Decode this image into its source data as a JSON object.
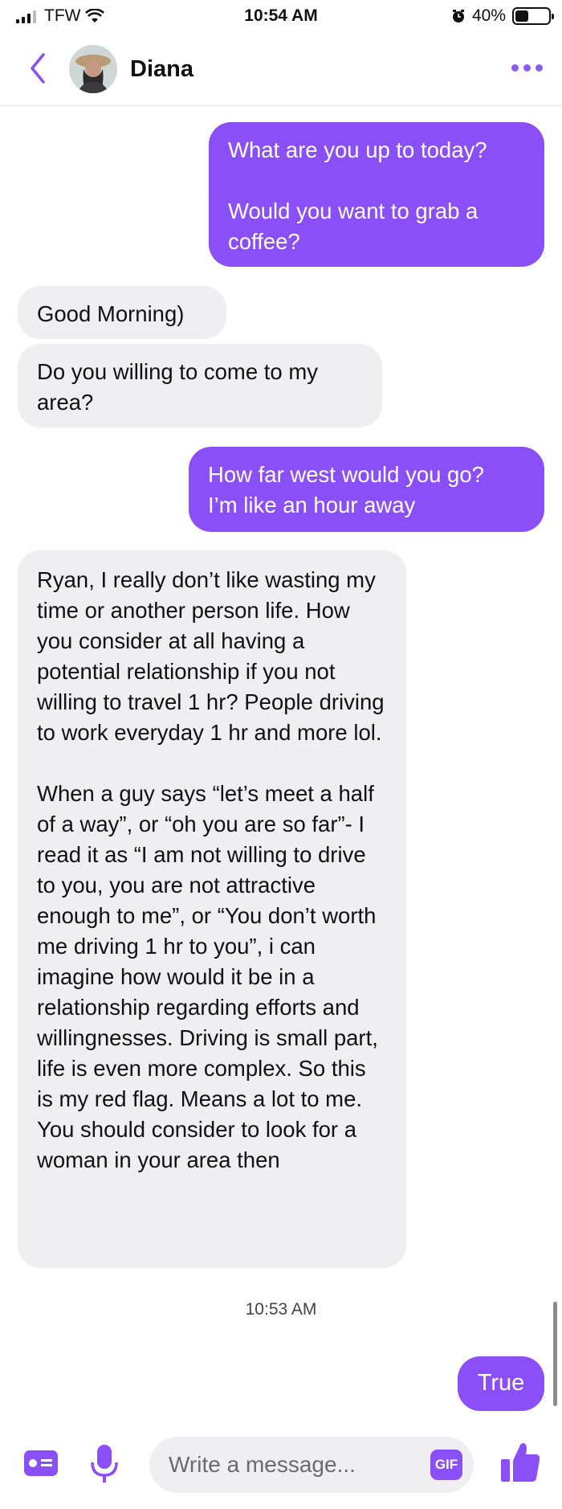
{
  "status_bar": {
    "carrier": "TFW",
    "time": "10:54 AM",
    "battery_percent": "40%",
    "battery_level": 0.4,
    "icons": [
      "signal-icon",
      "wifi-icon",
      "alarm-icon",
      "battery-icon"
    ]
  },
  "header": {
    "contact_name": "Diana",
    "icons": [
      "back-chevron-icon",
      "avatar",
      "more-dots-icon"
    ]
  },
  "messages": [
    {
      "from": "me",
      "text": "What are you up to today?\n\nWould you want to grab a coffee?"
    },
    {
      "from": "them",
      "text": "Good Morning)"
    },
    {
      "from": "them",
      "text": "Do you willing to come to my area?"
    },
    {
      "from": "me",
      "text": "How far west would you go?\nI’m like an hour away"
    },
    {
      "from": "them",
      "text": "Ryan, I really don’t like wasting my time or another person life. How you consider at all having a potential relationship if you not willing to travel 1 hr? People driving to work everyday 1 hr and more lol.\n\nWhen a guy says “let’s meet a half of a way”, or “oh you are so far”- I read it as “I am not willing to drive to you, you are not attractive enough to me”, or “You don’t worth me driving 1 hr to you”, i can imagine how would it be in a relationship regarding efforts and willingnesses. Driving is small part, life is even more complex. So this is my red flag. Means a lot to me. You should consider to look for a woman in your area then"
    },
    {
      "from": "me",
      "text": "True"
    }
  ],
  "timestamp": "10:53 AM",
  "composer": {
    "placeholder": "Write a message...",
    "gif_label": "GIF"
  },
  "colors": {
    "accent": "#8a4ff7",
    "incoming_bubble": "#efeff1",
    "outgoing_text": "#ffffff"
  }
}
